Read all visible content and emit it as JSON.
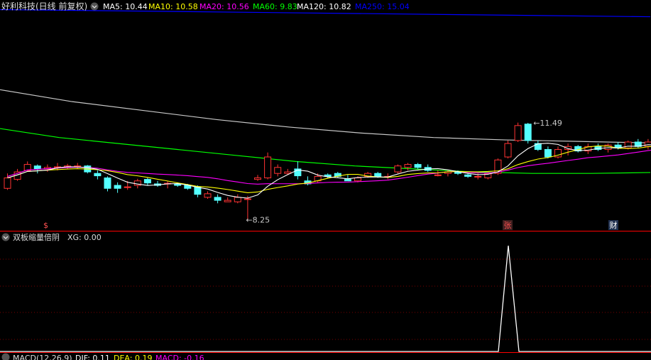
{
  "header": {
    "stock_name": "好利科技(日线 前复权)",
    "ma_items": [
      {
        "label": "MA5: 10.44",
        "color": "#ffffff"
      },
      {
        "label": "MA10: 10.58",
        "color": "#ffff00"
      },
      {
        "label": "MA20: 10.56",
        "color": "#ff00ff"
      },
      {
        "label": "MA60: 9.83",
        "color": "#00ff00"
      },
      {
        "label": "MA120: 10.82",
        "color": "#ffffff"
      },
      {
        "label": "MA250: 15.04",
        "color": "#0000ff"
      }
    ]
  },
  "markers": {
    "low_price": "8.25",
    "high_price": "11.49",
    "event_zhang": "张",
    "event_cai": "财",
    "event_dollar": "$"
  },
  "indicator": {
    "title": "双板缩量倍阴",
    "value_label": "XG: 0.00"
  },
  "macd": {
    "title": "MACD(12,26,9)",
    "dif": "DIF: 0.11",
    "dea": "DEA: 0.19",
    "macd": "MACD: -0.16"
  },
  "colors": {
    "up": "#ff3232",
    "down": "#54ffff",
    "axis": "#ff0000",
    "ma5": "#ffffff",
    "ma10": "#ffff00",
    "ma20": "#ff00ff",
    "ma60": "#00ff00",
    "ma120": "#c8c8c8",
    "ma250": "#0000ff"
  },
  "chart_data": {
    "type": "candlestick",
    "series": [
      {
        "name": "MA250",
        "values": [
          15.28,
          15.04
        ]
      },
      {
        "name": "MA120",
        "values": [
          12.6,
          12.2,
          11.9,
          11.6,
          11.35,
          11.15,
          11.0,
          10.92,
          10.87,
          10.82
        ]
      },
      {
        "name": "MA60",
        "values": [
          11.3,
          11.0,
          10.8,
          10.6,
          10.4,
          10.2,
          10.05,
          9.95,
          9.85,
          9.8,
          9.8,
          9.83
        ]
      }
    ],
    "candles": [
      [
        9.3,
        9.65,
        9.8,
        9.25
      ],
      [
        9.6,
        9.85,
        9.95,
        9.55
      ],
      [
        9.9,
        10.1,
        10.2,
        9.85
      ],
      [
        10.05,
        9.95,
        10.1,
        9.8
      ],
      [
        9.95,
        10.0,
        10.1,
        9.85
      ],
      [
        10.0,
        10.02,
        10.15,
        9.9
      ],
      [
        10.0,
        10.05,
        10.12,
        9.95
      ],
      [
        10.05,
        10.05,
        10.15,
        9.95
      ],
      [
        10.05,
        9.85,
        10.08,
        9.8
      ],
      [
        9.8,
        9.72,
        9.9,
        9.6
      ],
      [
        9.65,
        9.3,
        9.7,
        9.2
      ],
      [
        9.4,
        9.3,
        9.5,
        9.15
      ],
      [
        9.35,
        9.35,
        9.55,
        9.25
      ],
      [
        9.4,
        9.55,
        9.62,
        9.3
      ],
      [
        9.6,
        9.48,
        9.65,
        9.4
      ],
      [
        9.45,
        9.4,
        9.55,
        9.35
      ],
      [
        9.45,
        9.47,
        9.55,
        9.3
      ],
      [
        9.45,
        9.4,
        9.5,
        9.35
      ],
      [
        9.4,
        9.3,
        9.45,
        9.25
      ],
      [
        9.35,
        9.1,
        9.4,
        9.0
      ],
      [
        9.0,
        9.12,
        9.2,
        8.95
      ],
      [
        9.0,
        8.9,
        9.1,
        8.8
      ],
      [
        8.85,
        8.9,
        9.0,
        8.85
      ],
      [
        8.85,
        9.0,
        9.1,
        8.8
      ],
      [
        8.95,
        8.95,
        9.05,
        8.25
      ],
      [
        9.6,
        9.65,
        9.75,
        9.55
      ],
      [
        9.65,
        10.35,
        10.5,
        9.6
      ],
      [
        9.8,
        10.0,
        10.1,
        9.7
      ],
      [
        9.8,
        9.85,
        9.95,
        9.75
      ],
      [
        9.95,
        9.72,
        10.2,
        9.6
      ],
      [
        9.55,
        9.45,
        9.7,
        9.4
      ],
      [
        9.55,
        9.7,
        9.8,
        9.5
      ],
      [
        9.75,
        9.7,
        9.8,
        9.65
      ],
      [
        9.8,
        9.7,
        9.85,
        9.65
      ],
      [
        9.6,
        9.55,
        9.75,
        9.55
      ],
      [
        9.55,
        9.65,
        9.7,
        9.5
      ],
      [
        9.7,
        9.8,
        9.85,
        9.65
      ],
      [
        9.8,
        9.7,
        9.85,
        9.65
      ],
      [
        9.7,
        9.7,
        9.8,
        9.6
      ],
      [
        9.85,
        10.05,
        10.1,
        9.8
      ],
      [
        10.0,
        10.1,
        10.15,
        9.9
      ],
      [
        10.1,
        10.0,
        10.15,
        9.95
      ],
      [
        10.0,
        9.9,
        10.1,
        9.85
      ],
      [
        9.75,
        9.75,
        9.9,
        9.7
      ],
      [
        9.8,
        9.85,
        9.9,
        9.7
      ],
      [
        9.85,
        9.8,
        9.9,
        9.75
      ],
      [
        9.75,
        9.7,
        9.8,
        9.65
      ],
      [
        9.7,
        9.7,
        9.8,
        9.6
      ],
      [
        9.65,
        9.8,
        9.85,
        9.6
      ],
      [
        9.8,
        10.25,
        10.3,
        9.75
      ],
      [
        10.35,
        10.8,
        10.9,
        10.3
      ],
      [
        10.9,
        11.4,
        11.5,
        10.85
      ],
      [
        11.45,
        10.9,
        11.49,
        10.8
      ],
      [
        10.8,
        10.6,
        10.9,
        10.55
      ],
      [
        10.6,
        10.35,
        10.7,
        10.3
      ],
      [
        10.35,
        10.6,
        10.7,
        10.3
      ],
      [
        10.6,
        10.7,
        10.8,
        10.4
      ],
      [
        10.7,
        10.55,
        10.75,
        10.5
      ],
      [
        10.55,
        10.7,
        10.8,
        10.45
      ],
      [
        10.7,
        10.6,
        10.8,
        10.55
      ],
      [
        10.6,
        10.75,
        10.8,
        10.5
      ],
      [
        10.75,
        10.65,
        10.85,
        10.6
      ],
      [
        10.65,
        10.85,
        10.9,
        10.6
      ],
      [
        10.85,
        10.7,
        10.95,
        10.65
      ],
      [
        10.7,
        10.85,
        10.95,
        10.6
      ],
      [
        10.85,
        10.7,
        10.9,
        10.6
      ]
    ],
    "indicator": {
      "name": "XG",
      "spike_value": 1
    }
  }
}
